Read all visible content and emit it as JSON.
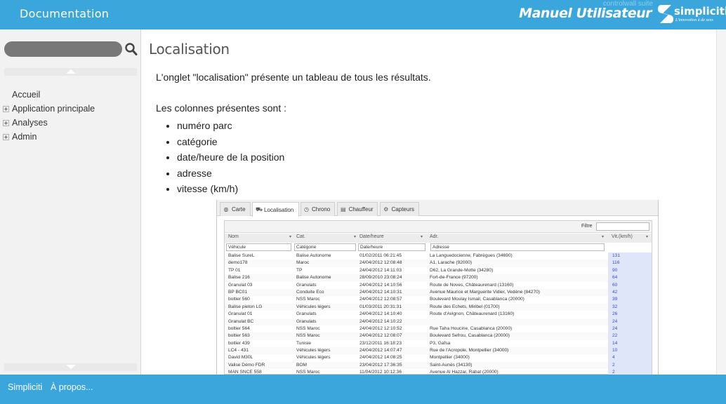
{
  "header": {
    "doc_title": "Documentation",
    "manual_title": "Manuel Utilisateur",
    "ghost_text": "controlwall suite",
    "logo": {
      "brand": "simpliciti",
      "tagline": "L'innovation à de sens"
    },
    "colors": {
      "bar": "#3aa6dc",
      "text": "#ffffff"
    }
  },
  "sidebar": {
    "search": {
      "placeholder": "",
      "value": ""
    },
    "nav": [
      {
        "label": "Accueil",
        "expandable": false
      },
      {
        "label": "Application principale",
        "expandable": true
      },
      {
        "label": "Analyses",
        "expandable": true
      },
      {
        "label": "Admin",
        "expandable": true
      }
    ]
  },
  "content": {
    "title": "Localisation",
    "intro": "L'onglet \"localisation\" présente un tableau de tous les résultats.",
    "columns_heading": "Les colonnes présentes sont :",
    "bullets": [
      "numéro parc",
      "catégorie",
      "date/heure de la position",
      "adresse",
      "vitesse (km/h)"
    ]
  },
  "screenshot": {
    "tabs": [
      {
        "label": "Carte",
        "icon": "globe-icon",
        "active": false
      },
      {
        "label": "Localisation",
        "icon": "car-icon",
        "active": true
      },
      {
        "label": "Chrono",
        "icon": "clock-icon",
        "active": false
      },
      {
        "label": "Chauffeur",
        "icon": "id-card-icon",
        "active": false
      },
      {
        "label": "Capteurs",
        "icon": "sensor-icon",
        "active": false
      }
    ],
    "filter_label": "Filtre",
    "headers": [
      "Nom",
      "Cat.",
      "Date/heure",
      "Adr.",
      "Vit.(km/h)"
    ],
    "column_filters": [
      "Véhicule",
      "Catégorie",
      "Date/heure",
      "Adresse"
    ],
    "rows": [
      [
        "Balise SureL",
        "Balise Autonome",
        "01/02/2011 06:21:45",
        "La Languedocienne, Fabrègues (34690)",
        "131"
      ],
      [
        "demo178",
        "Maroc",
        "24/04/2012 12:08:48",
        "A1, Larache (92000)",
        "116"
      ],
      [
        "TP 01",
        "TP",
        "24/04/2012 14:11:03",
        "D62, La Grande-Motte (34280)",
        "90"
      ],
      [
        "Balise 216",
        "Balise Autonome",
        "28/09/2010 23:08:24",
        "Fort-de-France (97200)",
        "64"
      ],
      [
        "Granulat 03",
        "Granulats",
        "24/04/2012 14:10:56",
        "Route de Noves, Châteaurenard (13160)",
        "60"
      ],
      [
        "BP BC01",
        "Conduite Eco",
        "24/04/2012 14:10:31",
        "Avenue Maurice et Marguerite Vidier, Vedène (84270)",
        "42"
      ],
      [
        "boltier 560",
        "NSS Maroc",
        "24/04/2012 12:08:57",
        "Boulevard Moulay Ismail, Casablanca (20000)",
        "39"
      ],
      [
        "Balise pieton LG",
        "Véhicules légers",
        "01/03/2011 20:31:31",
        "Route des Echets, Miribel (01700)",
        "32"
      ],
      [
        "Granulat 01",
        "Granulats",
        "24/04/2012 14:10:40",
        "Route d'Avignon, Châteaurenard (13160)",
        "26"
      ],
      [
        "Granulat BC",
        "Granulats",
        "24/04/2012 14:10:22",
        "",
        "24"
      ],
      [
        "boltier 564",
        "NSS Maroc",
        "24/04/2012 12:10:52",
        "Rue Taha Houcine, Casablanca (20000)",
        "24"
      ],
      [
        "boltier 563",
        "NSS Maroc",
        "24/04/2012 12:08:07",
        "Boulevard Sefrou, Casablanca (20000)",
        "22"
      ],
      [
        "boltier 439",
        "Tunisie",
        "23/12/2011 16:18:23",
        "P3, Gafsa",
        "14"
      ],
      [
        "LC4 - 431",
        "Véhicules légers",
        "24/04/2012 14:07:47",
        "Rue de l'Acropole, Montpellier (34000)",
        "10"
      ],
      [
        "David M30L",
        "Véhicules légers",
        "24/04/2012 14:08:25",
        "Montpellier (34000)",
        "4"
      ],
      [
        "Valise Démo FDR",
        "BOM",
        "23/04/2012 17:36:35",
        "Saint-Aunès (34130)",
        "2"
      ],
      [
        "MAN SNCE 558",
        "NSS Maroc",
        "11/04/2012 10:12:36",
        "Avenue Al Hazzar, Rabat (20000)",
        "2"
      ]
    ]
  },
  "footer": {
    "links": [
      "Simpliciti",
      "À propos..."
    ]
  }
}
